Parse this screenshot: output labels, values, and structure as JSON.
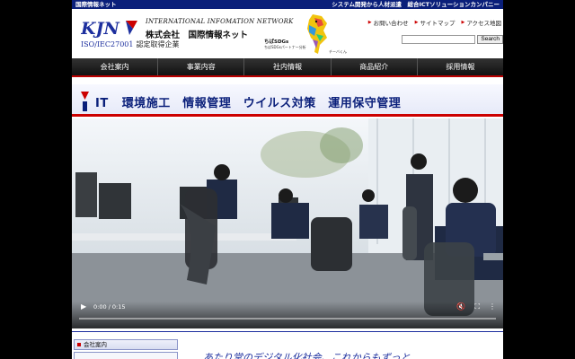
{
  "top_strip": {
    "left": "国際情報ネット",
    "right": "システム開発から人材派遣　総合ICTソリューションカンパニー"
  },
  "header": {
    "logo_text": "KJN",
    "iso_label": "ISO/IEC27001",
    "iso_suffix": "認定取得企業",
    "english_name": "INTERNATIONAL INFOMATION NETWORK",
    "company_name": "株式会社　国際情報ネット",
    "sdgs_title": "ちばSDGs",
    "sdgs_sub": "ちばSDGsパートナー分析",
    "sdgs_mascot": "チーバくん"
  },
  "util_nav": [
    {
      "label": "お問い合わせ"
    },
    {
      "label": "サイトマップ"
    },
    {
      "label": "アクセス地図"
    }
  ],
  "search": {
    "placeholder": "",
    "button": "Search"
  },
  "main_nav": [
    "会社案内",
    "事業内容",
    "社内情報",
    "商品紹介",
    "採用情報"
  ],
  "banner": {
    "text": "IT 環境施工　情報管理　ウイルス対策　運用保守管理"
  },
  "video": {
    "time": "0:00 / 0:15",
    "progress": 0
  },
  "sidebar": {
    "item1": "会社案内"
  },
  "lead": "あたり堂のデジタル化社会、これからもずっと",
  "colors": {
    "navy": "#0a1f7a",
    "red": "#c00000",
    "nav_bg": "#1a1a1a"
  }
}
